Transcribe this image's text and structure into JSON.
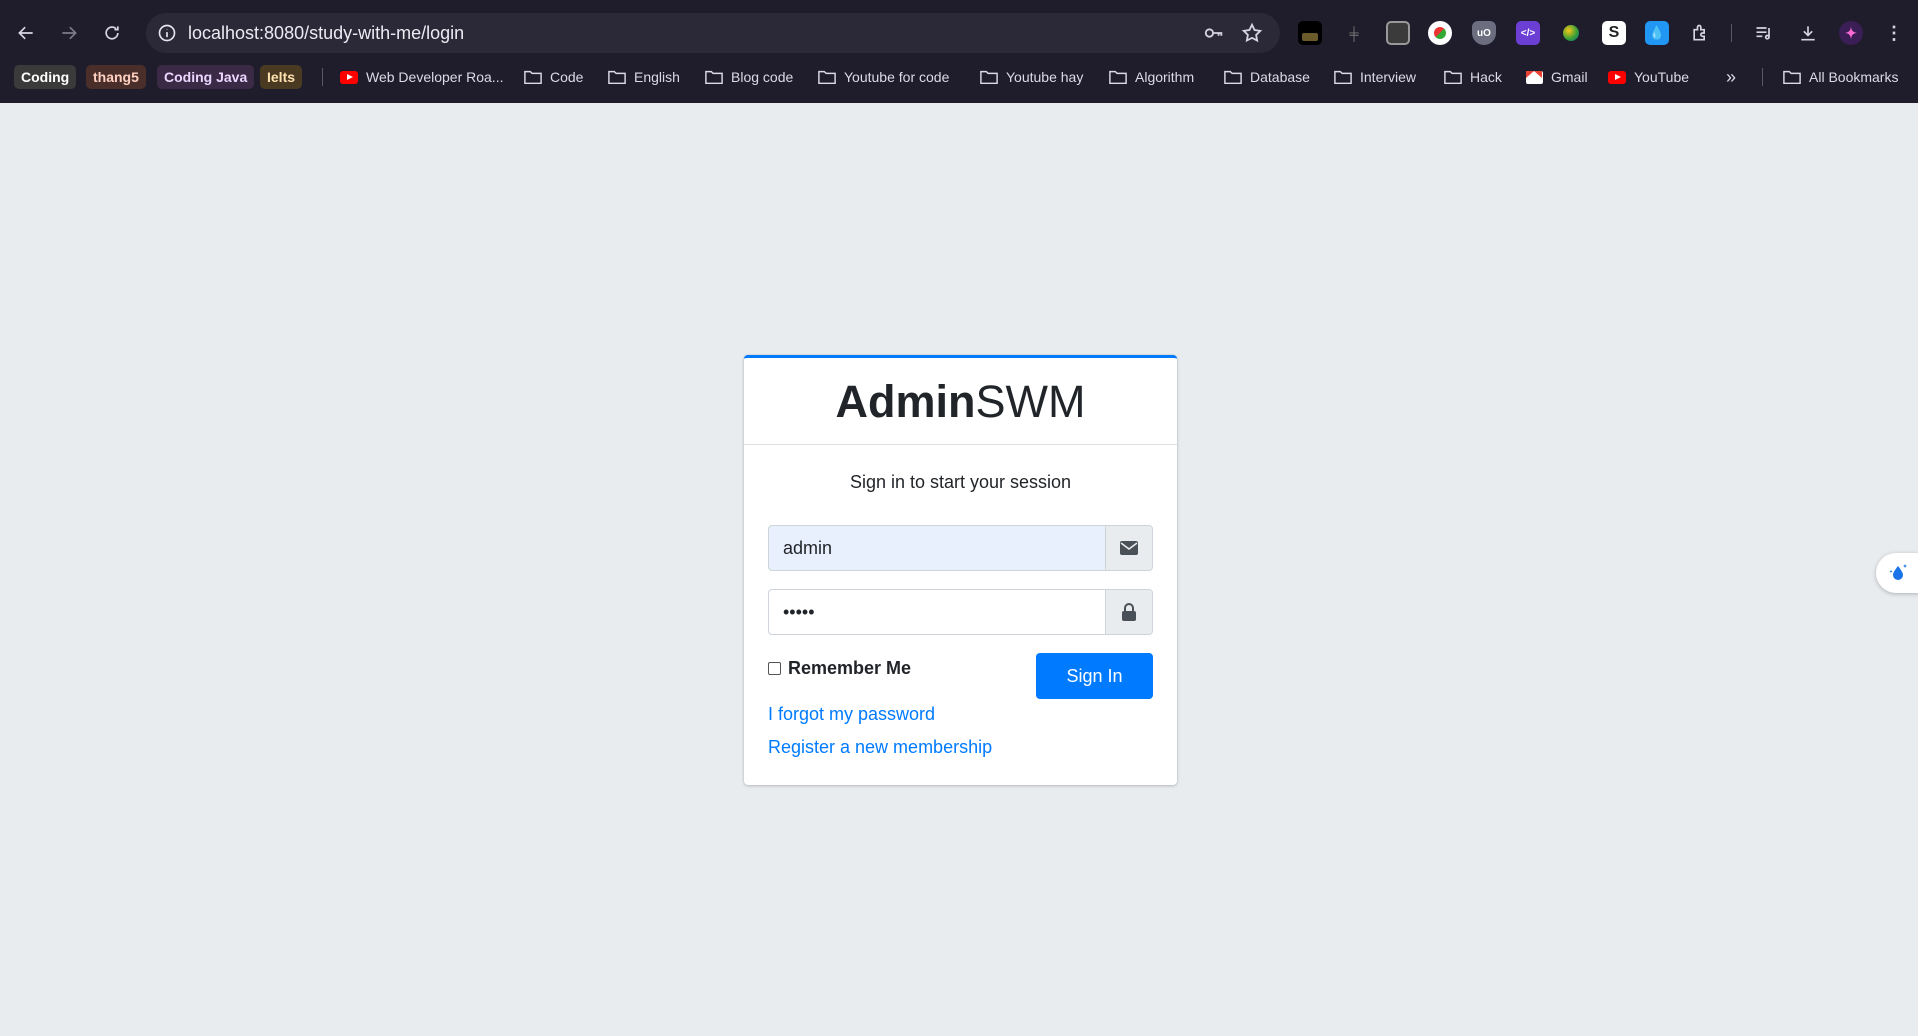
{
  "browser": {
    "url": "localhost:8080/study-with-me/login",
    "bookmarks": {
      "tags": [
        {
          "label": "Coding",
          "color": "#3a3a3a"
        },
        {
          "label": "thang5",
          "color": "#4a2e2a"
        },
        {
          "label": "Coding Java",
          "color": "#3b2a45"
        },
        {
          "label": "Ielts",
          "color": "#4a3a22"
        }
      ],
      "items": [
        {
          "label": "Web Developer Roa...",
          "icon": "youtube-icon"
        },
        {
          "label": "Code",
          "icon": "folder-icon"
        },
        {
          "label": "English",
          "icon": "folder-icon"
        },
        {
          "label": "Blog code",
          "icon": "folder-icon"
        },
        {
          "label": "Youtube for code",
          "icon": "folder-icon"
        },
        {
          "label": "Youtube hay",
          "icon": "folder-icon"
        },
        {
          "label": "Algorithm",
          "icon": "folder-icon"
        },
        {
          "label": "Database",
          "icon": "folder-icon"
        },
        {
          "label": "Interview",
          "icon": "folder-icon"
        },
        {
          "label": "Hack",
          "icon": "folder-icon"
        },
        {
          "label": "Gmail",
          "icon": "gmail-icon"
        },
        {
          "label": "YouTube",
          "icon": "youtube-icon"
        }
      ],
      "all_bookmarks": "All Bookmarks"
    }
  },
  "login": {
    "brand_bold": "Admin",
    "brand_light": "SWM",
    "message": "Sign in to start your session",
    "email_value": "admin",
    "password_value": "•••••",
    "remember_label": "Remember Me",
    "signin_label": "Sign In",
    "forgot_link": "I forgot my password",
    "register_link": "Register a new membership"
  },
  "colors": {
    "primary": "#007bff",
    "page_bg": "#e9ecef",
    "chrome_bg": "#1f1d2b"
  }
}
